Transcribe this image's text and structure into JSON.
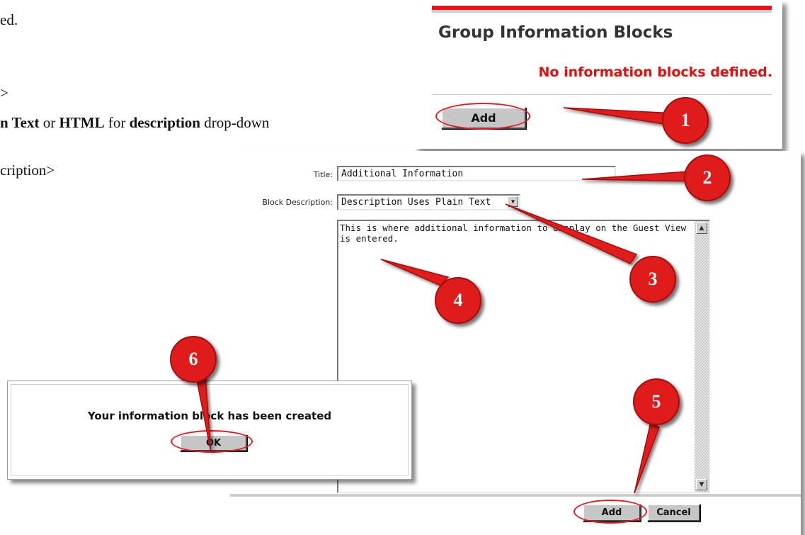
{
  "instructions": {
    "line1": "ed.",
    "line2": ">",
    "line3": {
      "part1": "n Text",
      "or1": " or ",
      "part2": "HTML",
      "for1": " for ",
      "part3": "description",
      "rest": " drop-down"
    },
    "line4": "cription>"
  },
  "group_panel": {
    "heading": "Group Information Blocks",
    "empty_message": "No information blocks defined.",
    "add_button": "Add"
  },
  "form": {
    "title_label": "Title:",
    "title_value": "Additional Information",
    "description_label": "Block Description:",
    "description_selected": "Description Uses Plain Text",
    "body_text": "This is where additional information to display on the Guest View is entered.",
    "add_button": "Add",
    "cancel_button": "Cancel"
  },
  "dialog": {
    "message": "Your information block has been created",
    "ok_button": "OK"
  },
  "callouts": [
    "1",
    "2",
    "3",
    "4",
    "5",
    "6"
  ],
  "colors": {
    "accent_red": "#e01b1b",
    "header_bar": "#e8141b",
    "empty_text": "#e01010"
  }
}
